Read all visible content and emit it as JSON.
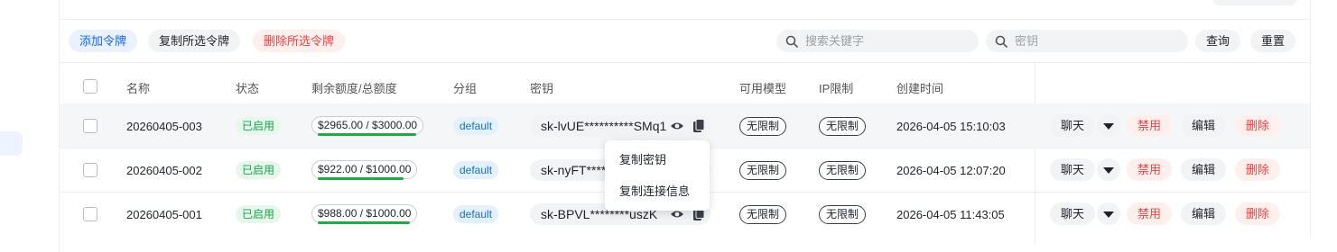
{
  "toolbar": {
    "add_label": "添加令牌",
    "copy_selected_label": "复制所选令牌",
    "delete_selected_label": "删除所选令牌",
    "search_keyword_placeholder": "搜索关键字",
    "search_key_placeholder": "密钥",
    "query_label": "查询",
    "reset_label": "重置"
  },
  "table": {
    "headers": [
      "名称",
      "状态",
      "剩余额度/总额度",
      "分组",
      "密钥",
      "可用模型",
      "IP限制",
      "创建时间"
    ],
    "rows": [
      {
        "name": "20260405-003",
        "status": "已启用",
        "quota": "$2965.00 / $3000.00",
        "quota_ratio": 0.988,
        "group": "default",
        "key": "sk-lvUE**********SMq1",
        "models": "无限制",
        "ip": "无限制",
        "created": "2026-04-05 15:10:03"
      },
      {
        "name": "20260405-002",
        "status": "已启用",
        "quota": "$922.00 / $1000.00",
        "quota_ratio": 0.922,
        "group": "default",
        "key": "sk-nyFT****",
        "models": "无限制",
        "ip": "无限制",
        "created": "2026-04-05 12:07:20"
      },
      {
        "name": "20260405-001",
        "status": "已启用",
        "quota": "$988.00 / $1000.00",
        "quota_ratio": 0.988,
        "group": "default",
        "key": "sk-BPVL********uszK",
        "models": "无限制",
        "ip": "无限制",
        "created": "2026-04-05 11:43:05"
      }
    ],
    "actions": {
      "chat": "聊天",
      "disable": "禁用",
      "edit": "编辑",
      "delete": "删除"
    }
  },
  "copy_menu": {
    "items": [
      "复制密钥",
      "复制连接信息"
    ]
  }
}
